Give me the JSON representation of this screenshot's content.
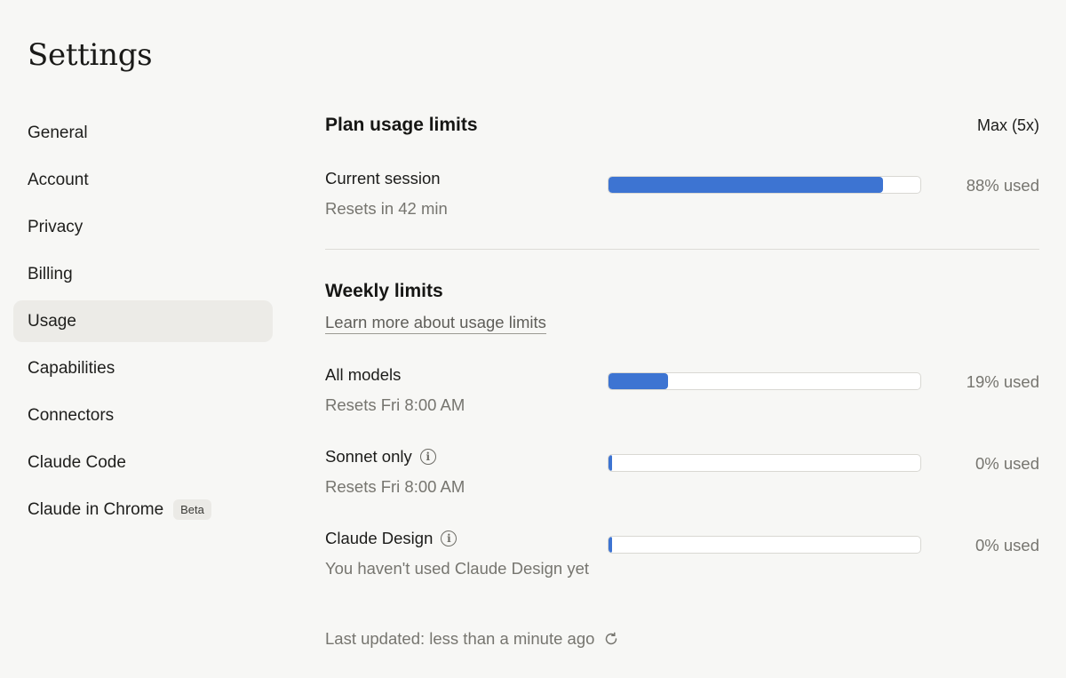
{
  "page": {
    "title": "Settings"
  },
  "sidebar": {
    "items": [
      {
        "label": "General"
      },
      {
        "label": "Account"
      },
      {
        "label": "Privacy"
      },
      {
        "label": "Billing"
      },
      {
        "label": "Usage",
        "active": true
      },
      {
        "label": "Capabilities"
      },
      {
        "label": "Connectors"
      },
      {
        "label": "Claude Code"
      },
      {
        "label": "Claude in Chrome",
        "badge": "Beta"
      }
    ]
  },
  "plan_usage": {
    "title": "Plan usage limits",
    "plan": "Max (5x)",
    "current_session": {
      "name": "Current session",
      "sub": "Resets in 42 min",
      "percent": 88,
      "percent_label": "88% used"
    }
  },
  "weekly": {
    "title": "Weekly limits",
    "learn_more": "Learn more about usage limits",
    "rows": [
      {
        "name": "All models",
        "sub": "Resets Fri 8:00 AM",
        "percent": 19,
        "percent_label": "19% used",
        "info": false
      },
      {
        "name": "Sonnet only",
        "sub": "Resets Fri 8:00 AM",
        "percent": 0,
        "percent_label": "0% used",
        "info": true
      },
      {
        "name": "Claude Design",
        "sub": "You haven't used Claude Design yet",
        "percent": 0,
        "percent_label": "0% used",
        "info": true
      }
    ]
  },
  "footer": {
    "last_updated": "Last updated: less than a minute ago"
  },
  "colors": {
    "accent": "#3d74d2",
    "background": "#f7f7f5",
    "active_nav": "#ecebe7"
  },
  "icons": {
    "info": "info-icon",
    "refresh": "refresh-icon"
  }
}
